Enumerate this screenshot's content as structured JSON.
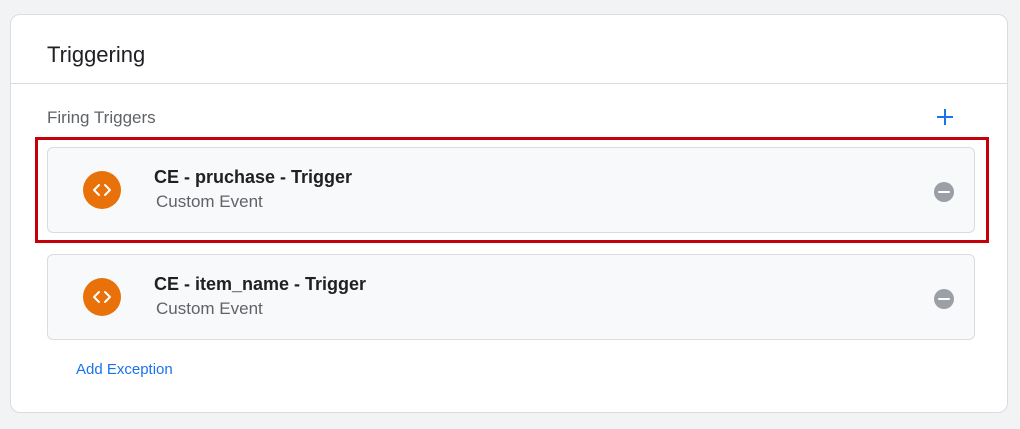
{
  "card": {
    "title": "Triggering"
  },
  "firing_triggers": {
    "label": "Firing Triggers",
    "add_icon": "plus-icon",
    "items": [
      {
        "name": "CE - pruchase - Trigger",
        "type": "Custom Event",
        "icon": "custom-event-code-icon",
        "highlighted": true
      },
      {
        "name": "CE - item_name - Trigger",
        "type": "Custom Event",
        "icon": "custom-event-code-icon",
        "highlighted": false
      }
    ]
  },
  "exceptions": {
    "add_label": "Add Exception"
  },
  "colors": {
    "accent": "#1a73e8",
    "trigger_icon": "#e8710a",
    "highlight": "#c5000b",
    "remove_icon": "#9aa0a6"
  }
}
